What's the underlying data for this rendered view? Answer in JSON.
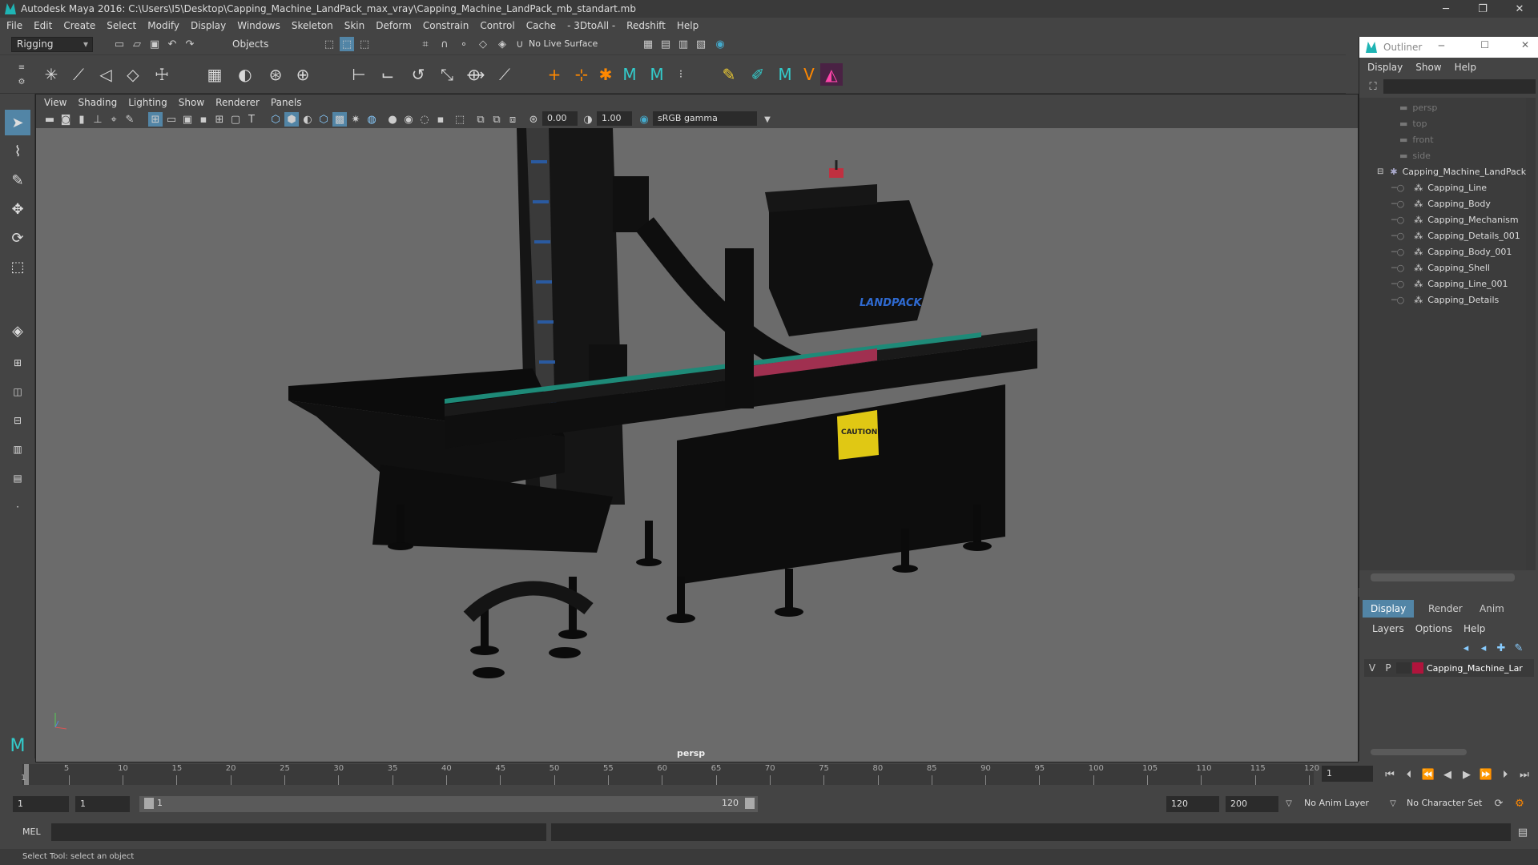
{
  "titlebar": {
    "title": "Autodesk Maya 2016: C:\\Users\\I5\\Desktop\\Capping_Machine_LandPack_max_vray\\Capping_Machine_LandPack_mb_standart.mb",
    "minimize": "─",
    "maximize": "❐",
    "close": "✕"
  },
  "menubar": [
    "File",
    "Edit",
    "Create",
    "Select",
    "Modify",
    "Display",
    "Windows",
    "Skeleton",
    "Skin",
    "Deform",
    "Constrain",
    "Control",
    "Cache",
    "- 3DtoAll -",
    "Redshift",
    "Help"
  ],
  "statusline": {
    "mode": "Rigging",
    "selection_mask": "Objects",
    "live_surface": "No Live Surface"
  },
  "panel": {
    "menu": [
      "View",
      "Shading",
      "Lighting",
      "Show",
      "Renderer",
      "Panels"
    ],
    "exposure": "0.00",
    "gamma": "1.00",
    "colorspace": "sRGB gamma",
    "camera": "persp"
  },
  "outliner": {
    "title": "Outliner",
    "menu": [
      "Display",
      "Show",
      "Help"
    ],
    "cameras": [
      "persp",
      "top",
      "front",
      "side"
    ],
    "root": "Capping_Machine_LandPack",
    "children": [
      "Capping_Line",
      "Capping_Body",
      "Capping_Mechanism",
      "Capping_Details_001",
      "Capping_Body_001",
      "Capping_Shell",
      "Capping_Line_001",
      "Capping_Details"
    ]
  },
  "layers": {
    "tabs": [
      "Display",
      "Render",
      "Anim"
    ],
    "menu": [
      "Layers",
      "Options",
      "Help"
    ],
    "layer": {
      "v": "V",
      "p": "P",
      "name": "Capping_Machine_Lar",
      "color": "#b0143c"
    }
  },
  "timeline": {
    "ticks": [
      "5",
      "10",
      "15",
      "20",
      "25",
      "30",
      "35",
      "40",
      "45",
      "50",
      "55",
      "60",
      "65",
      "70",
      "75",
      "80",
      "85",
      "90",
      "95",
      "100",
      "105",
      "110",
      "115",
      "120"
    ],
    "start_marker": "1",
    "current_frame": "1"
  },
  "range": {
    "start": "1",
    "anim_start": "1",
    "slider_start": "1",
    "slider_end": "120",
    "anim_end": "120",
    "end": "200",
    "anim_layer": "No Anim Layer",
    "character_set": "No Character Set"
  },
  "cmdline": {
    "label": "MEL"
  },
  "helpline": {
    "text": "Select Tool: select an object"
  },
  "machine": {
    "brand": "LANDPACK",
    "caution": "CAUTION"
  },
  "colors": {
    "accent": "#5285a6",
    "maya_teal": "#1fb4b4",
    "viewport_bg": "#6b6b6b"
  }
}
